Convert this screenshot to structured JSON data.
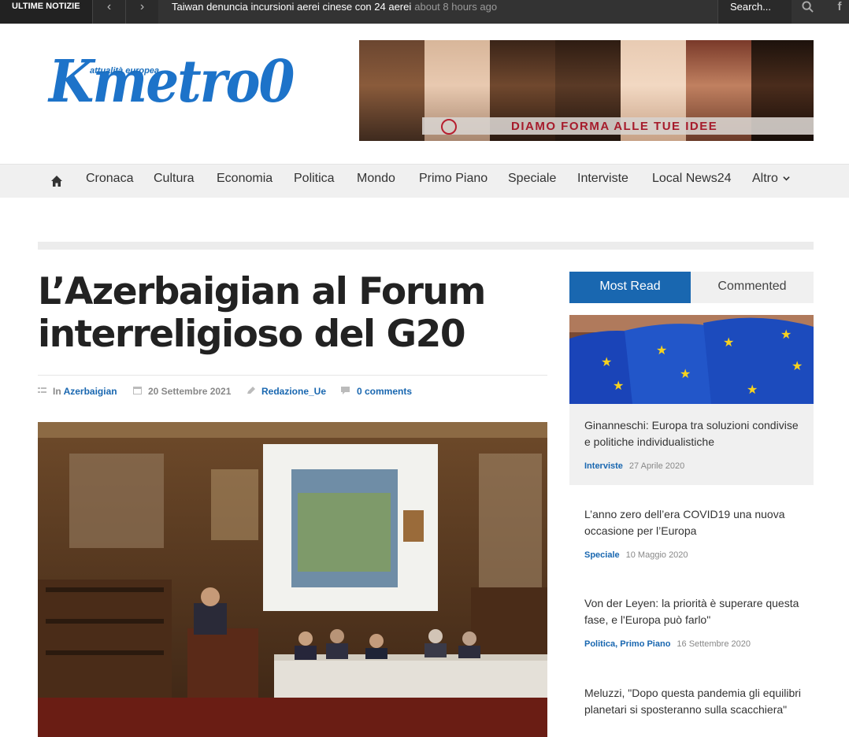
{
  "topbar": {
    "label": "ULTIME NOTIZIE",
    "prev_icon": "chevron-left-icon",
    "next_icon": "chevron-right-icon",
    "ticker_text": "Taiwan denuncia incursioni aerei cinese con 24 aerei",
    "ticker_time": "about 8 hours ago",
    "search_placeholder": "Search...",
    "search_icon": "search-icon",
    "facebook_icon": "facebook-icon"
  },
  "brand": {
    "logo_text": "Kmetro0",
    "logo_subtitle": "attualità europea",
    "banner_text": "DIAMO FORMA ALLE TUE IDEE",
    "banner_color": "#a61b2b"
  },
  "nav": {
    "home_icon": "home-icon",
    "items": [
      "Cronaca",
      "Cultura",
      "Economia",
      "Politica",
      "Mondo",
      "Primo Piano",
      "Speciale",
      "Interviste",
      "Local News24",
      "Altro"
    ]
  },
  "article": {
    "title": "L’Azerbaigian al Forum interreligioso del G20",
    "category_prefix": "In",
    "category": "Azerbaigian",
    "date": "20 Settembre 2021",
    "author": "Redazione_Ue",
    "comments": "0 comments"
  },
  "sidebar": {
    "tabs": [
      "Most Read",
      "Commented"
    ],
    "accent": "#1967b0",
    "items": [
      {
        "title": "Ginanneschi: Europa tra soluzioni condivise e politiche individualistiche",
        "category": "Interviste",
        "date": "27 Aprile 2020"
      },
      {
        "title": "L’anno zero dell’era COVID19 una nuova occasione per l’Europa",
        "category": "Speciale",
        "date": "10 Maggio 2020"
      },
      {
        "title": "Von der Leyen: la priorità è superare questa fase, e l'Europa può farlo\"",
        "category": "Politica, Primo Piano",
        "date": "16 Settembre 2020"
      },
      {
        "title": "Meluzzi, \"Dopo questa pandemia gli equilibri planetari si sposteranno sulla scacchiera\"",
        "category": "",
        "date": ""
      }
    ]
  }
}
